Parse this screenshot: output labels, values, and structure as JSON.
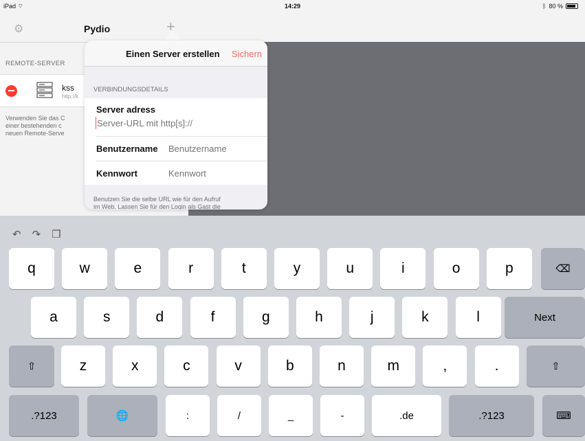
{
  "status_bar": {
    "device": "iPad",
    "time": "14:29",
    "battery": "80 %"
  },
  "sidebar": {
    "title": "Pydio",
    "section_header": "REMOTE-SERVER",
    "server": {
      "name": "kss",
      "url": "http://k"
    },
    "footer_lines": [
      "Verwenden Sie das C",
      "einer bestehenden c",
      "neuen Remote-Serve"
    ]
  },
  "popover": {
    "title": "Einen Server erstellen",
    "save_label": "Sichern",
    "section_header": "VERBINDUNGSDETAILS",
    "server_label": "Server adress",
    "server_placeholder": "Server-URL mit http[s]://",
    "username_label": "Benutzername",
    "username_placeholder": "Benutzername",
    "password_label": "Kennwort",
    "password_placeholder": "Kennwort",
    "footer_lines": [
      "Benutzen Sie die selbe URL wie für den Aufruf",
      "im Web. Lassen Sie für den Login als Gast die"
    ]
  },
  "keyboard": {
    "row1": [
      "q",
      "w",
      "e",
      "r",
      "t",
      "y",
      "u",
      "i",
      "o",
      "p"
    ],
    "row2": [
      "a",
      "s",
      "d",
      "f",
      "g",
      "h",
      "j",
      "k",
      "l"
    ],
    "next": "Next",
    "row3": [
      "z",
      "x",
      "c",
      "v",
      "b",
      "n",
      "m",
      ",",
      "."
    ],
    "row4": [
      ".?123",
      ":",
      "/",
      "_",
      "-",
      ".de",
      ".?123"
    ]
  }
}
